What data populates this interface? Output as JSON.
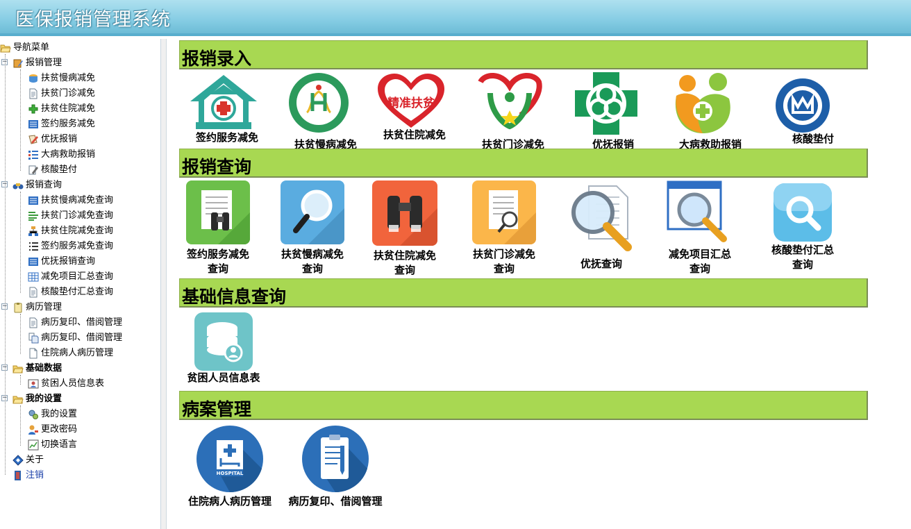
{
  "app": {
    "title": "医保报销管理系统"
  },
  "nav": {
    "root": "导航菜单",
    "groups": [
      {
        "label": "报销管理",
        "items": [
          "扶贫慢病减免",
          "扶贫门诊减免",
          "扶贫住院减免",
          "签约服务减免",
          "优抚报销",
          "大病救助报销",
          "核酸垫付"
        ]
      },
      {
        "label": "报销查询",
        "items": [
          "扶贫慢病减免查询",
          "扶贫门诊减免查询",
          "扶贫住院减免查询",
          "签约服务减免查询",
          "优抚报销查询",
          "减免项目汇总查询",
          "核酸垫付汇总查询"
        ]
      },
      {
        "label": "病历管理",
        "items": [
          "病历复印、借阅管理",
          "病历复印、借阅管理",
          "住院病人病历管理"
        ]
      },
      {
        "label": "基础数据",
        "items": [
          "贫困人员信息表"
        ]
      },
      {
        "label": "我的设置",
        "items": [
          "我的设置",
          "更改密码",
          "切换语言"
        ]
      }
    ],
    "about": "关于",
    "logout": "注销"
  },
  "sections": [
    {
      "title": "报销录入",
      "tiles": [
        "签约服务减免",
        "扶贫慢病减免",
        "扶贫住院减免",
        "扶贫门诊减免",
        "优抚报销",
        "大病救助报销",
        "核酸垫付"
      ]
    },
    {
      "title": "报销查询",
      "tiles": [
        "签约服务减免\n查询",
        "扶贫慢病减免\n查询",
        "扶贫住院减免\n查询",
        "扶贫门诊减免\n查询",
        "优抚查询",
        "减免项目汇总\n查询",
        "核酸垫付汇总\n查询"
      ]
    },
    {
      "title": "基础信息查询",
      "tiles": [
        "贫困人员信息表"
      ]
    },
    {
      "title": "病案管理",
      "tiles": [
        "住院病人病历管理",
        "病历复印、借阅管理"
      ]
    }
  ],
  "icons": {
    "logo_text_1": "精准扶贫",
    "hospital_sign": "HOSPITAL"
  },
  "colors": {
    "section_bar": "#a8d852",
    "header": "#86cde4"
  }
}
